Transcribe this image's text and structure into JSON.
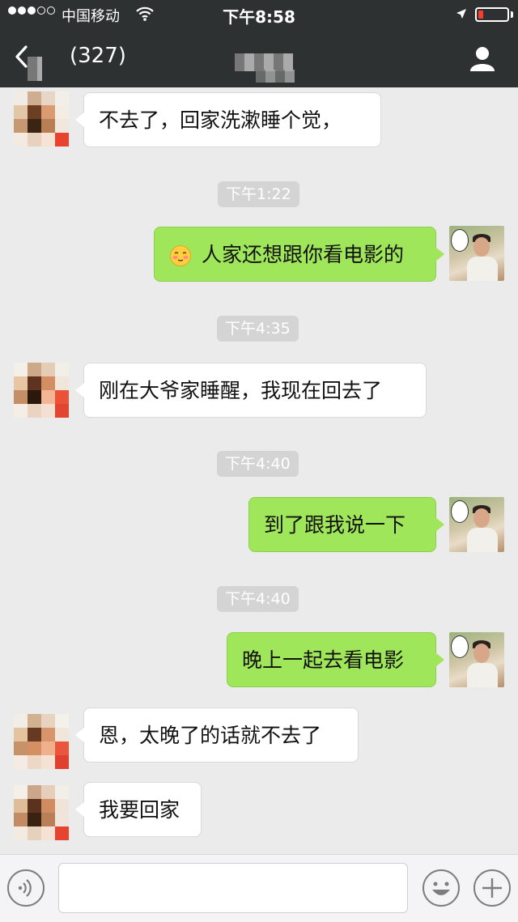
{
  "status_bar": {
    "carrier": "中国移动",
    "time": "下午8:58"
  },
  "nav": {
    "title": "(327)"
  },
  "messages": [
    {
      "side": "peer",
      "text": "不去了，回家洗漱睡个觉，"
    },
    {
      "time": "下午1:22"
    },
    {
      "side": "me",
      "text": "人家还想跟你看电影的",
      "emoji": "blushing-face-icon"
    },
    {
      "time": "下午4:35"
    },
    {
      "side": "peer",
      "text": "刚在大爷家睡醒，我现在回去了"
    },
    {
      "time": "下午4:40"
    },
    {
      "side": "me",
      "text": "到了跟我说一下"
    },
    {
      "time": "下午4:40"
    },
    {
      "side": "me",
      "text": "晚上一起去看电影"
    },
    {
      "side": "peer",
      "text": "恩，太晚了的话就不去了"
    },
    {
      "side": "peer",
      "text": "我要回家"
    }
  ],
  "input": {
    "placeholder": ""
  },
  "colors": {
    "header": "#2e3132",
    "chat_background": "#ebebeb",
    "my_bubble": "#a0e65a",
    "peer_bubble": "#ffffff",
    "timestamp_chip": "#d4d4d4"
  }
}
